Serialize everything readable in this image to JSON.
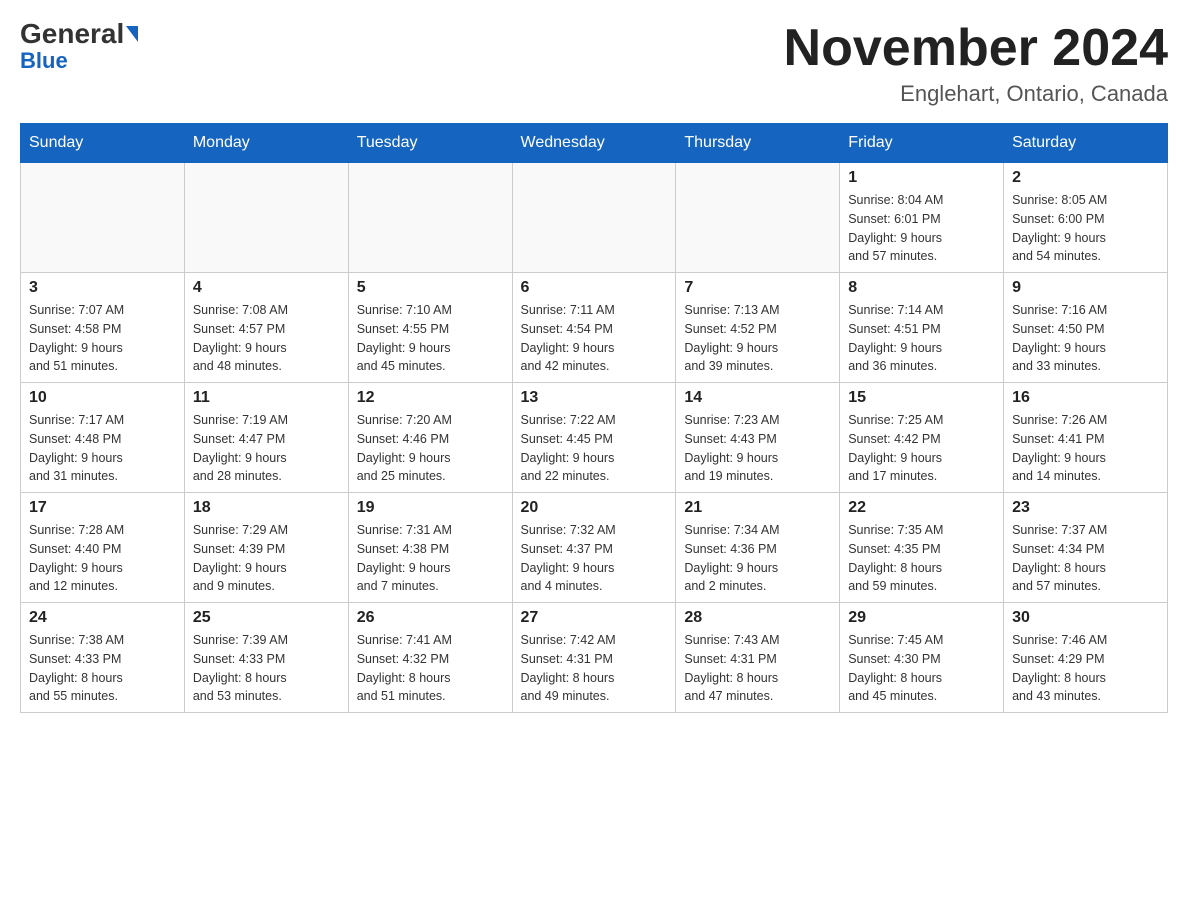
{
  "header": {
    "logo": {
      "general": "General",
      "blue": "Blue"
    },
    "title": "November 2024",
    "location": "Englehart, Ontario, Canada"
  },
  "calendar": {
    "weekdays": [
      "Sunday",
      "Monday",
      "Tuesday",
      "Wednesday",
      "Thursday",
      "Friday",
      "Saturday"
    ],
    "weeks": [
      [
        {
          "day": "",
          "info": ""
        },
        {
          "day": "",
          "info": ""
        },
        {
          "day": "",
          "info": ""
        },
        {
          "day": "",
          "info": ""
        },
        {
          "day": "",
          "info": ""
        },
        {
          "day": "1",
          "info": "Sunrise: 8:04 AM\nSunset: 6:01 PM\nDaylight: 9 hours\nand 57 minutes."
        },
        {
          "day": "2",
          "info": "Sunrise: 8:05 AM\nSunset: 6:00 PM\nDaylight: 9 hours\nand 54 minutes."
        }
      ],
      [
        {
          "day": "3",
          "info": "Sunrise: 7:07 AM\nSunset: 4:58 PM\nDaylight: 9 hours\nand 51 minutes."
        },
        {
          "day": "4",
          "info": "Sunrise: 7:08 AM\nSunset: 4:57 PM\nDaylight: 9 hours\nand 48 minutes."
        },
        {
          "day": "5",
          "info": "Sunrise: 7:10 AM\nSunset: 4:55 PM\nDaylight: 9 hours\nand 45 minutes."
        },
        {
          "day": "6",
          "info": "Sunrise: 7:11 AM\nSunset: 4:54 PM\nDaylight: 9 hours\nand 42 minutes."
        },
        {
          "day": "7",
          "info": "Sunrise: 7:13 AM\nSunset: 4:52 PM\nDaylight: 9 hours\nand 39 minutes."
        },
        {
          "day": "8",
          "info": "Sunrise: 7:14 AM\nSunset: 4:51 PM\nDaylight: 9 hours\nand 36 minutes."
        },
        {
          "day": "9",
          "info": "Sunrise: 7:16 AM\nSunset: 4:50 PM\nDaylight: 9 hours\nand 33 minutes."
        }
      ],
      [
        {
          "day": "10",
          "info": "Sunrise: 7:17 AM\nSunset: 4:48 PM\nDaylight: 9 hours\nand 31 minutes."
        },
        {
          "day": "11",
          "info": "Sunrise: 7:19 AM\nSunset: 4:47 PM\nDaylight: 9 hours\nand 28 minutes."
        },
        {
          "day": "12",
          "info": "Sunrise: 7:20 AM\nSunset: 4:46 PM\nDaylight: 9 hours\nand 25 minutes."
        },
        {
          "day": "13",
          "info": "Sunrise: 7:22 AM\nSunset: 4:45 PM\nDaylight: 9 hours\nand 22 minutes."
        },
        {
          "day": "14",
          "info": "Sunrise: 7:23 AM\nSunset: 4:43 PM\nDaylight: 9 hours\nand 19 minutes."
        },
        {
          "day": "15",
          "info": "Sunrise: 7:25 AM\nSunset: 4:42 PM\nDaylight: 9 hours\nand 17 minutes."
        },
        {
          "day": "16",
          "info": "Sunrise: 7:26 AM\nSunset: 4:41 PM\nDaylight: 9 hours\nand 14 minutes."
        }
      ],
      [
        {
          "day": "17",
          "info": "Sunrise: 7:28 AM\nSunset: 4:40 PM\nDaylight: 9 hours\nand 12 minutes."
        },
        {
          "day": "18",
          "info": "Sunrise: 7:29 AM\nSunset: 4:39 PM\nDaylight: 9 hours\nand 9 minutes."
        },
        {
          "day": "19",
          "info": "Sunrise: 7:31 AM\nSunset: 4:38 PM\nDaylight: 9 hours\nand 7 minutes."
        },
        {
          "day": "20",
          "info": "Sunrise: 7:32 AM\nSunset: 4:37 PM\nDaylight: 9 hours\nand 4 minutes."
        },
        {
          "day": "21",
          "info": "Sunrise: 7:34 AM\nSunset: 4:36 PM\nDaylight: 9 hours\nand 2 minutes."
        },
        {
          "day": "22",
          "info": "Sunrise: 7:35 AM\nSunset: 4:35 PM\nDaylight: 8 hours\nand 59 minutes."
        },
        {
          "day": "23",
          "info": "Sunrise: 7:37 AM\nSunset: 4:34 PM\nDaylight: 8 hours\nand 57 minutes."
        }
      ],
      [
        {
          "day": "24",
          "info": "Sunrise: 7:38 AM\nSunset: 4:33 PM\nDaylight: 8 hours\nand 55 minutes."
        },
        {
          "day": "25",
          "info": "Sunrise: 7:39 AM\nSunset: 4:33 PM\nDaylight: 8 hours\nand 53 minutes."
        },
        {
          "day": "26",
          "info": "Sunrise: 7:41 AM\nSunset: 4:32 PM\nDaylight: 8 hours\nand 51 minutes."
        },
        {
          "day": "27",
          "info": "Sunrise: 7:42 AM\nSunset: 4:31 PM\nDaylight: 8 hours\nand 49 minutes."
        },
        {
          "day": "28",
          "info": "Sunrise: 7:43 AM\nSunset: 4:31 PM\nDaylight: 8 hours\nand 47 minutes."
        },
        {
          "day": "29",
          "info": "Sunrise: 7:45 AM\nSunset: 4:30 PM\nDaylight: 8 hours\nand 45 minutes."
        },
        {
          "day": "30",
          "info": "Sunrise: 7:46 AM\nSunset: 4:29 PM\nDaylight: 8 hours\nand 43 minutes."
        }
      ]
    ]
  }
}
